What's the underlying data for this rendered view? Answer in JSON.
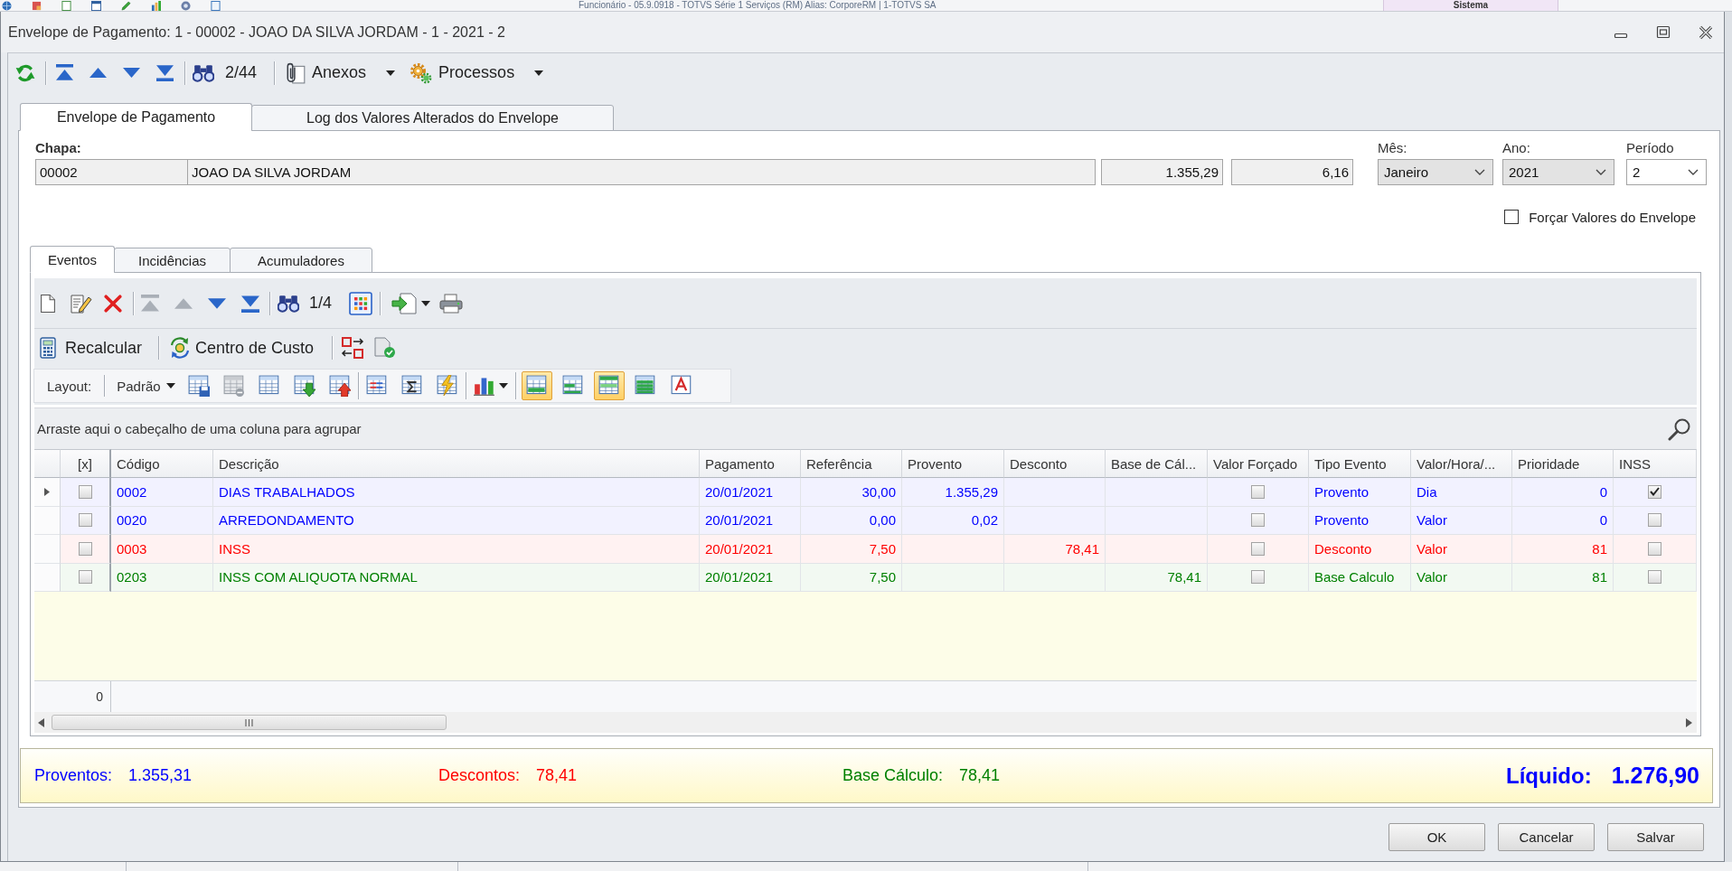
{
  "parent_window": {
    "title": "Funcionário - 05.9.0918 - TOTVS Série 1 Serviços (RM) Alias: CorporeRM | 1-TOTVS SA",
    "tab": "Sistema"
  },
  "window": {
    "title": "Envelope de Pagamento: 1 - 00002 - JOAO DA SILVA JORDAM - 1 - 2021 - 2"
  },
  "toolbar": {
    "nav": [
      {
        "disabled": false
      },
      {
        "disabled": false
      },
      {
        "disabled": false
      },
      {
        "disabled": false
      }
    ],
    "counter": "2/44",
    "menus": [
      "Anexos",
      "Processos"
    ]
  },
  "tabs": [
    {
      "label": "Envelope de Pagamento",
      "selected": true
    },
    {
      "label": "Log dos Valores Alterados do Envelope",
      "selected": false
    }
  ],
  "employee": {
    "label": "Chapa:",
    "code": "00002",
    "name": "JOAO DA SILVA JORDAM",
    "amount": "1.355,29",
    "factor": "6,16"
  },
  "period": [
    {
      "label": "Mês:",
      "value": "Janeiro",
      "read_only": true
    },
    {
      "label": "Ano:",
      "value": "2021",
      "read_only": true
    },
    {
      "label": "Período",
      "value": "2",
      "read_only": false
    }
  ],
  "force_values": {
    "label": "Forçar Valores do Envelope",
    "checked": false
  },
  "inner_tabs": [
    {
      "label": "Eventos",
      "selected": true
    },
    {
      "label": "Incidências",
      "selected": false
    },
    {
      "label": "Acumuladores",
      "selected": false
    }
  ],
  "events_toolbar": {
    "nav": [
      {
        "disabled": true
      },
      {
        "disabled": true
      },
      {
        "disabled": false
      },
      {
        "disabled": false
      }
    ],
    "counter": "1/4"
  },
  "actions": [
    "Recalcular",
    "Centro de Custo"
  ],
  "layout_toolbar": {
    "label": "Layout:",
    "preset": "Padrão",
    "tool_groups": [
      [
        {
          "kind": "save",
          "disabled": false
        },
        {
          "kind": "remove",
          "disabled": true
        },
        {
          "kind": "grid",
          "disabled": false
        },
        {
          "kind": "import",
          "disabled": false
        },
        {
          "kind": "export",
          "disabled": false
        }
      ],
      [
        {
          "kind": "columns",
          "disabled": false
        },
        {
          "kind": "sum",
          "disabled": false
        },
        {
          "kind": "format",
          "disabled": false
        }
      ],
      [
        {
          "kind": "chart",
          "disabled": false
        }
      ]
    ],
    "view_toggles": [
      {
        "kind": "preview",
        "on": true
      },
      {
        "kind": "footer",
        "on": false
      },
      {
        "kind": "header",
        "on": true
      },
      {
        "kind": "rows",
        "on": false
      },
      {
        "kind": "text",
        "on": false
      }
    ]
  },
  "group_panel": {
    "hint": "Arraste aqui o cabeçalho de uma coluna para agrupar"
  },
  "table": {
    "columns": [
      "[x]",
      "Código",
      "Descrição",
      "Pagamento",
      "Referência",
      "Provento",
      "Desconto",
      "Base de Cál...",
      "Valor Forçado",
      "Tipo Evento",
      "Valor/Hora/...",
      "Prioridade",
      "INSS"
    ],
    "rows": [
      {
        "selected": true,
        "color": "#0000ff",
        "checked": false,
        "code": "0002",
        "description": "DIAS TRABALHADOS",
        "payment": "20/01/2021",
        "reference": "30,00",
        "earning": "1.355,29",
        "forced": false,
        "type": "Provento",
        "unit": "Dia",
        "priority": "0",
        "inss": true
      },
      {
        "selected": false,
        "color": "#0000ff",
        "checked": false,
        "code": "0020",
        "description": "ARREDONDAMENTO",
        "payment": "20/01/2021",
        "reference": "0,00",
        "earning": "0,02",
        "forced": false,
        "type": "Provento",
        "unit": "Valor",
        "priority": "0",
        "inss": false
      },
      {
        "selected": false,
        "color": "#ff0000",
        "checked": false,
        "code": "0003",
        "description": "INSS",
        "payment": "20/01/2021",
        "reference": "7,50",
        "deduction": "78,41",
        "forced": false,
        "type": "Desconto",
        "unit": "Valor",
        "priority": "81",
        "inss": false
      },
      {
        "selected": false,
        "color": "#008000",
        "checked": false,
        "code": "0203",
        "description": "INSS COM ALIQUOTA NORMAL",
        "payment": "20/01/2021",
        "reference": "7,50",
        "base": "78,41",
        "forced": false,
        "type": "Base Calculo",
        "unit": "Valor",
        "priority": "81",
        "inss": false
      }
    ],
    "footer": "0"
  },
  "totals": [
    {
      "kind": "total",
      "label": "Proventos:",
      "value": "1.355,31",
      "color": "#0000ff"
    },
    {
      "kind": "total",
      "label": "Descontos:",
      "value": "78,41",
      "color": "#ff0000"
    },
    {
      "kind": "total",
      "label": "Base Cálculo:",
      "value": "78,41",
      "color": "#008000"
    },
    {
      "kind": "net",
      "label": "Líquido:",
      "value": "1.276,90",
      "color": "#0000ff"
    }
  ],
  "buttons": [
    "OK",
    "Cancelar",
    "Salvar"
  ]
}
